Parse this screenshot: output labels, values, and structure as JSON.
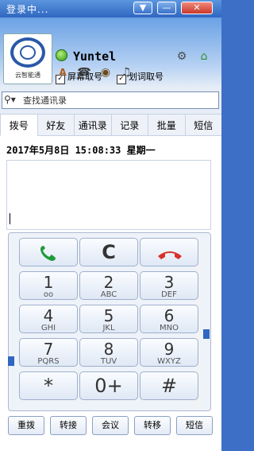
{
  "window": {
    "title": "登录中...",
    "minimize_icon": "chevron-down-icon",
    "restore_icon": "minus-icon",
    "close_icon": "close-icon"
  },
  "header": {
    "logo_text": "云智能通",
    "username": "Yuntel",
    "options": [
      {
        "label": "屏幕取号",
        "checked": true
      },
      {
        "label": "划词取号",
        "checked": true
      }
    ]
  },
  "search": {
    "placeholder": "查找通讯录"
  },
  "tabs": [
    {
      "label": "拨号",
      "active": true
    },
    {
      "label": "好友"
    },
    {
      "label": "通讯录"
    },
    {
      "label": "记录"
    },
    {
      "label": "批量"
    },
    {
      "label": "短信"
    }
  ],
  "dialer": {
    "datetime": "2017年5月8日  15:08:33  星期一",
    "keys": [
      {
        "digit": "1",
        "letters": "oo"
      },
      {
        "digit": "2",
        "letters": "ABC"
      },
      {
        "digit": "3",
        "letters": "DEF"
      },
      {
        "digit": "4",
        "letters": "GHI"
      },
      {
        "digit": "5",
        "letters": "JKL"
      },
      {
        "digit": "6",
        "letters": "MNO"
      },
      {
        "digit": "7",
        "letters": "PQRS"
      },
      {
        "digit": "8",
        "letters": "TUV"
      },
      {
        "digit": "9",
        "letters": "WXYZ"
      },
      {
        "digit": "*",
        "letters": ""
      },
      {
        "digit": "0+",
        "letters": ""
      },
      {
        "digit": "#",
        "letters": ""
      }
    ],
    "clear_label": "C"
  },
  "actions": [
    {
      "label": "重拨"
    },
    {
      "label": "转接"
    },
    {
      "label": "会议"
    },
    {
      "label": "转移"
    },
    {
      "label": "短信"
    }
  ],
  "colors": {
    "titlebar": "#2f67c1",
    "call_green": "#1f9a3a",
    "hangup_red": "#d9302a",
    "accent_blue": "#2f67c1"
  }
}
